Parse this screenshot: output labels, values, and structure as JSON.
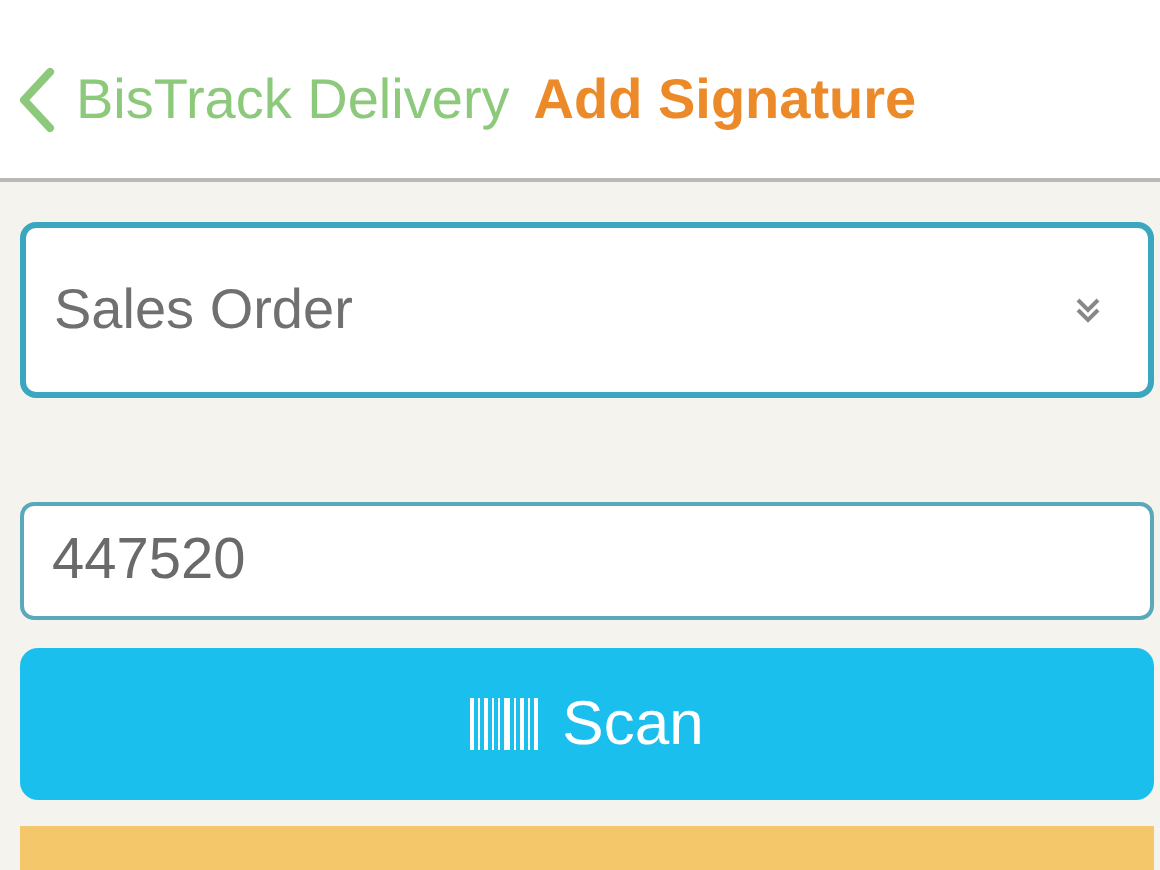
{
  "nav": {
    "back_label": "BisTrack Delivery",
    "title": "Add Signature"
  },
  "order_type": {
    "value": "Sales Order"
  },
  "order_number": {
    "value": "447520"
  },
  "scan_button": {
    "label": "Scan"
  }
}
